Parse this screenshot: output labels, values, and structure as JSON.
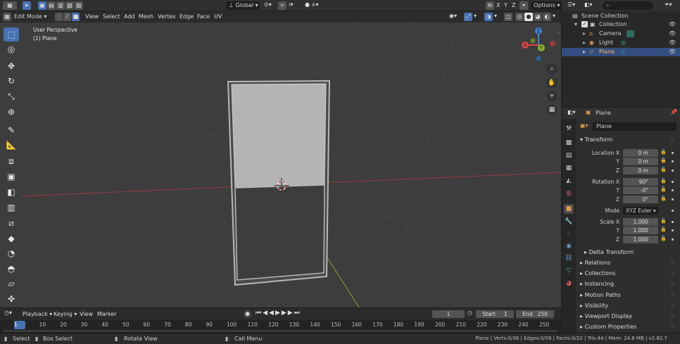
{
  "header": {
    "mode": "Edit Mode",
    "menus": [
      "View",
      "Select",
      "Add",
      "Mesh",
      "Vertex",
      "Edge",
      "Face",
      "UV"
    ],
    "orientation": "Global",
    "axes": [
      "X",
      "Y",
      "Z"
    ],
    "options": "Options"
  },
  "viewport": {
    "perspective": "User Perspective",
    "object": "(1) Plane",
    "gizmo": {
      "x": "X",
      "y": "Y",
      "z": "Z"
    }
  },
  "timeline": {
    "menus": [
      "Playback",
      "Keying",
      "View",
      "Marker"
    ],
    "current_frame": "1",
    "start_label": "Start",
    "start": "1",
    "end_label": "End",
    "end": "250",
    "ticks": [
      "1",
      "10",
      "20",
      "30",
      "40",
      "50",
      "60",
      "70",
      "80",
      "90",
      "100",
      "110",
      "120",
      "130",
      "140",
      "150",
      "160",
      "170",
      "180",
      "190",
      "200",
      "210",
      "220",
      "230",
      "240",
      "250"
    ]
  },
  "statusbar": {
    "select": "Select",
    "box_select": "Box Select",
    "rotate": "Rotate View",
    "call_menu": "Call Menu",
    "stats": "Plane | Verts:0/36 | Edges:0/56 | Faces:0/22 | Tris:44 | Mem: 24.8 MB | v2.82.7"
  },
  "outliner": {
    "scene_collection": "Scene Collection",
    "collection": "Collection",
    "items": [
      {
        "name": "Camera"
      },
      {
        "name": "Light"
      },
      {
        "name": "Plane"
      }
    ]
  },
  "properties": {
    "header_name": "Plane",
    "object_name": "Plane",
    "transform": {
      "title": "Transform",
      "location_label": "Location X",
      "loc_x": "0 m",
      "loc_y": "0 m",
      "loc_z": "0 m",
      "rotation_label": "Rotation X",
      "rot_x": "90°",
      "rot_y": "-0°",
      "rot_z": "0°",
      "mode_label": "Mode",
      "mode": "XYZ Euler",
      "scale_label": "Scale X",
      "scale_x": "1.000",
      "scale_y": "1.000",
      "scale_z": "1.000",
      "y": "Y",
      "z": "Z"
    },
    "delta_transform": "Delta Transform",
    "sections": [
      "Relations",
      "Collections",
      "Instancing",
      "Motion Paths",
      "Visibility",
      "Viewport Display",
      "Custom Properties"
    ]
  },
  "colors": {
    "accent": "#4772b3",
    "x_axis": "#d8444c",
    "y_axis": "#88b02d",
    "z_axis": "#3e82d4"
  }
}
